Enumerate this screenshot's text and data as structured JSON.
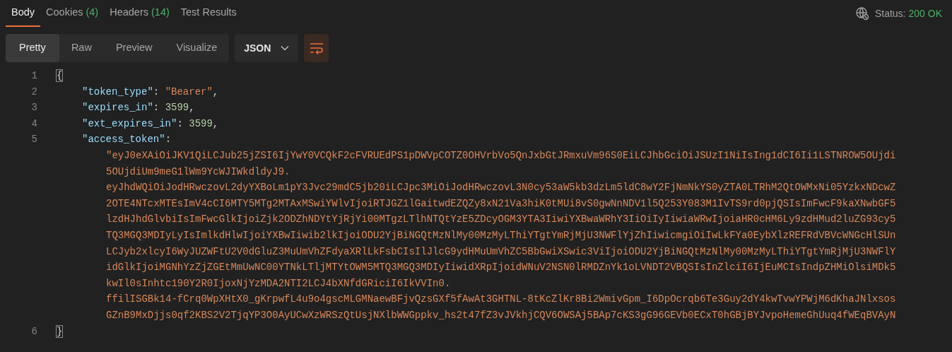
{
  "tabs": [
    {
      "label": "Body",
      "selected": true
    },
    {
      "label": "Cookies",
      "count": "(4)",
      "selected": false
    },
    {
      "label": "Headers",
      "count": "(14)",
      "selected": false
    },
    {
      "label": "Test Results",
      "selected": false
    }
  ],
  "status": {
    "label": "Status:",
    "value": "200 OK"
  },
  "view_modes": [
    {
      "label": "Pretty",
      "selected": true
    },
    {
      "label": "Raw",
      "selected": false
    },
    {
      "label": "Preview",
      "selected": false
    },
    {
      "label": "Visualize",
      "selected": false
    }
  ],
  "format": "JSON",
  "wrap_lines": true,
  "lines": [
    {
      "number": "1",
      "segments": [
        {
          "kind": "brace",
          "text": "{",
          "matched": true
        }
      ]
    },
    {
      "number": "2",
      "segments": [
        {
          "kind": "key",
          "text": "\"token_type\""
        },
        {
          "kind": "punct",
          "text": ": "
        },
        {
          "kind": "string",
          "text": "\"Bearer\""
        },
        {
          "kind": "punct",
          "text": ","
        }
      ]
    },
    {
      "number": "3",
      "segments": [
        {
          "kind": "key",
          "text": "\"expires_in\""
        },
        {
          "kind": "punct",
          "text": ": "
        },
        {
          "kind": "number",
          "text": "3599"
        },
        {
          "kind": "punct",
          "text": ","
        }
      ]
    },
    {
      "number": "4",
      "segments": [
        {
          "kind": "key",
          "text": "\"ext_expires_in\""
        },
        {
          "kind": "punct",
          "text": ": "
        },
        {
          "kind": "number",
          "text": "3599"
        },
        {
          "kind": "punct",
          "text": ","
        }
      ]
    },
    {
      "number": "5",
      "segments": [
        {
          "kind": "key",
          "text": "\"access_token\""
        },
        {
          "kind": "punct",
          "text": ":"
        }
      ],
      "wrapped": [
        "\"eyJ0eXAiOiJKV1QiLCJub25jZSI6IjYwY0VCQkF2cFVRUEdPS1pDWVpCOTZ0OHVrbVo5QnJxbGtJRmxuVm96S0EiLCJhbGciOiJSUzI1NiIsIng1dCI6Ii1LSTNROW5OUjdi",
        "5OUjdiUm9meG1lWm9YcWJIWkdldyJ9.",
        "eyJhdWQiOiJodHRwczovL2dyYXBoLm1pY3Jvc29mdC5jb20iLCJpc3MiOiJodHRwczovL3N0cy53aW5kb3dzLm5ldC8wY2FjNmNkYS0yZTA0LTRhM2QtOWMxNi05YzkxNDcwZ",
        "2OTE4NTcxMTEsImV4cCI6MTY5MTg2MTAxMSwiYWlvIjoiRTJGZ1lGaitwdEZQZy8xN21Va3hiK0tMUi8vS0gwNnNDV1l5Q253Y083M1IvTS9rd0pjQSIsImFwcF9kaXNwbGF5",
        "lzdHJhdGlvbiIsImFwcGlkIjoiZjk2ODZhNDYtYjRjYi00MTgzLTlhNTQtYzE5ZDcyOGM3YTA3IiwiYXBwaWRhY3IiOiIyIiwiaWRwIjoiaHR0cHM6Ly9zdHMud2luZG93cy5",
        "TQ3MGQ3MDIyLyIsImlkdHlwIjoiYXBwIiwib2lkIjoiODU2YjBiNGQtMzNlMy00MzMyLThiYTgtYmRjMjU3NWFlYjZhIiwicmgiOiIwLkFYa0EybXlzREFRdVBVcWNGcHlSUn",
        "LCJyb2xlcyI6WyJUZWFtU2V0dGluZ3MuUmVhZFdyaXRlLkFsbCIsIlJlcG9ydHMuUmVhZC5BbGwiXSwic3ViIjoiODU2YjBiNGQtMzNlMy00MzMyLThiYTgtYmRjMjU3NWFlY",
        "idGlkIjoiMGNhYzZjZGEtMmUwNC00YTNkLTljMTYtOWM5MTQ3MGQ3MDIyIiwidXRpIjoidWNuV2NSN0lRMDZnYk1oLVNDT2VBQSIsInZlciI6IjEuMCIsIndpZHMiOlsiMDk5",
        "kwIl0sInhtc190Y2R0IjoxNjYzMDA2NTI2LCJ4bXNfdGRiciI6IkVVIn0.",
        "ffilISGBk14-fCrq0WpXHtX0_gKrpwfL4u9o4gscMLGMNaewBFjvQzsGXf5fAwAt3GHTNL-8tKcZlKr8Bi2WmivGpm_I6DpOcrqb6Te3Guy2dY4kwTvwYPWjM6dKhaJNlxsos",
        "GZnB9MxDjjs0qf2KBS2V2TjqYP3O0AyUCwXzWRSzQtUsjNXlbWWGppkv_hs2t47fZ3vJVkhjCQV6OWSAj5BAp7cKS3gG96GEVb0ECxT0hGBjBYJvpoHemeGhUuq4fWEqBVAyN"
      ]
    },
    {
      "number": "6",
      "segments": [
        {
          "kind": "brace",
          "text": "}",
          "matched": true
        }
      ]
    }
  ]
}
